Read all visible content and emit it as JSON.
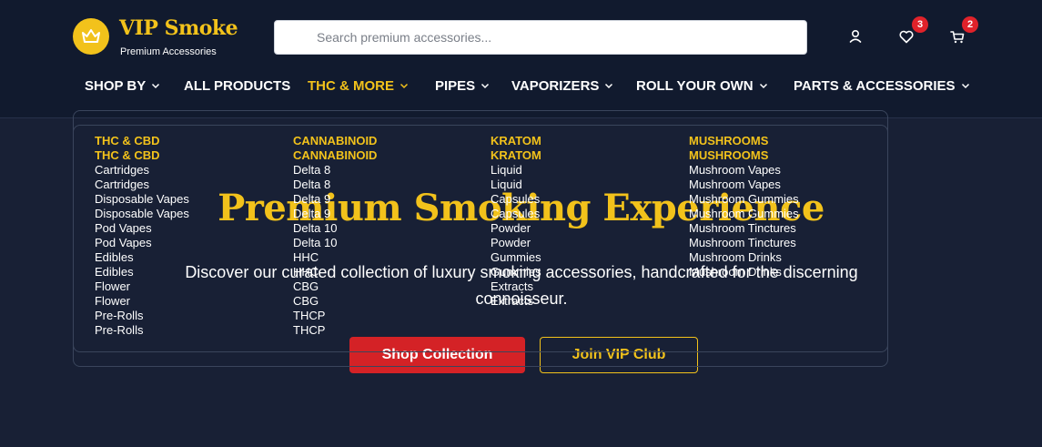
{
  "brand": {
    "title": "VIP Smoke",
    "subtitle": "Premium Accessories",
    "logo_icon": "crown-icon"
  },
  "search": {
    "placeholder": "Search premium accessories...",
    "value": ""
  },
  "header_icons": {
    "wishlist_count": "3",
    "cart_count": "2"
  },
  "nav": [
    {
      "label": "SHOP BY",
      "has_dropdown": true
    },
    {
      "label": "ALL PRODUCTS",
      "has_dropdown": false
    },
    {
      "label": "THC & MORE",
      "has_dropdown": true,
      "active": true
    },
    {
      "label": "PIPES",
      "has_dropdown": true
    },
    {
      "label": "VAPORIZERS",
      "has_dropdown": true
    },
    {
      "label": "ROLL YOUR OWN",
      "has_dropdown": true
    },
    {
      "label": "PARTS & ACCESSORIES",
      "has_dropdown": true
    }
  ],
  "mega_menu": {
    "columns": [
      {
        "heading": "THC & CBD",
        "items": [
          "Cartridges",
          "Disposable Vapes",
          "Pod Vapes",
          "Edibles",
          "Flower",
          "Pre-Rolls"
        ]
      },
      {
        "heading": "CANNABINOID",
        "items": [
          "Delta 8",
          "Delta 9",
          "Delta 10",
          "HHC",
          "CBG",
          "THCP"
        ]
      },
      {
        "heading": "KRATOM",
        "items": [
          "Liquid",
          "Capsules",
          "Powder",
          "Gummies",
          "Extracts"
        ]
      },
      {
        "heading": "MUSHROOMS",
        "items": [
          "Mushroom Vapes",
          "Mushroom Gummies",
          "Mushroom Tinctures",
          "Mushroom Drinks"
        ]
      }
    ]
  },
  "hero": {
    "title": "Premium Smoking Experience",
    "subtitle": "Discover our curated collection of luxury smoking accessories, handcrafted for the discerning connoisseur.",
    "primary_button": "Shop Collection",
    "secondary_button": "Join VIP Club"
  },
  "colors": {
    "accent": "#f2c21b",
    "background": "#182035",
    "header": "#111a2e",
    "primary": "#d42226",
    "badge": "#e0222a"
  }
}
